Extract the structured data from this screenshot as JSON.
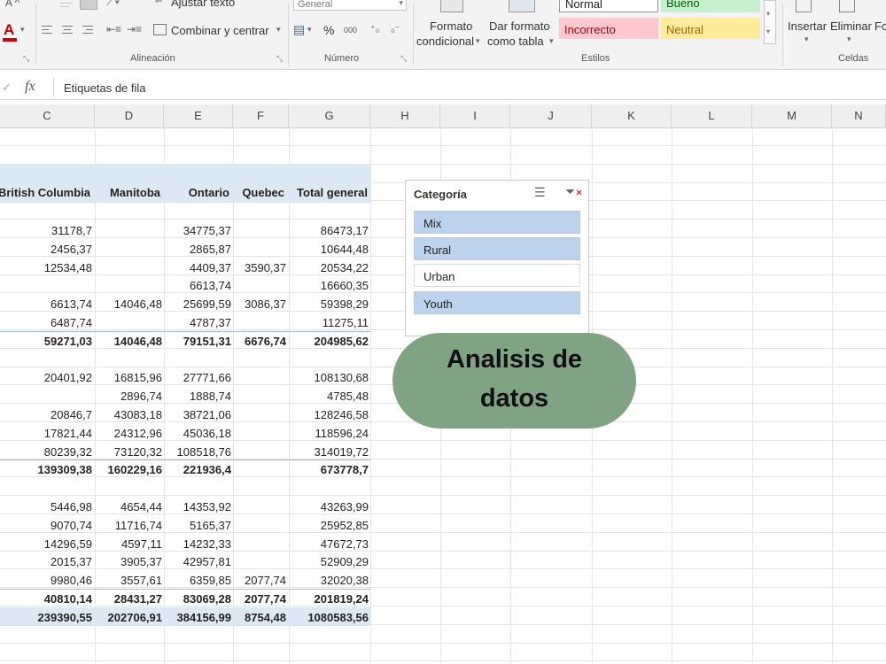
{
  "ribbon": {
    "alignment": {
      "wrap_text": "Ajustar texto",
      "merge_center": "Combinar y centrar",
      "group_label": "Alineación"
    },
    "number": {
      "format_value": "General",
      "percent": "%",
      "thousands": "000",
      "group_label": "Número"
    },
    "styles": {
      "conditional_format_line1": "Formato",
      "conditional_format_line2": "condicional",
      "format_table_line1": "Dar formato",
      "format_table_line2": "como tabla",
      "normal": "Normal",
      "good": "Bueno",
      "bad": "Incorrecto",
      "neutral": "Neutral",
      "group_label": "Estilos"
    },
    "cells": {
      "insert": "Insertar",
      "delete": "Eliminar",
      "format_partial": "Fo",
      "group_label": "Celdas"
    },
    "font_color_letter": "A"
  },
  "formula_bar": {
    "fx": "fx",
    "content": "Etiquetas de fila"
  },
  "columns": [
    "C",
    "D",
    "E",
    "F",
    "G",
    "H",
    "I",
    "J",
    "K",
    "L",
    "M",
    "N"
  ],
  "pivot": {
    "headers": [
      "British Columbia",
      "Manitoba",
      "Ontario",
      "Quebec",
      "Total general"
    ],
    "rows": [
      [
        "31178,7",
        "",
        "34775,37",
        "",
        "86473,17"
      ],
      [
        "2456,37",
        "",
        "2865,87",
        "",
        "10644,48"
      ],
      [
        "12534,48",
        "",
        "4409,37",
        "3590,37",
        "20534,22"
      ],
      [
        "",
        "",
        "6613,74",
        "",
        "16660,35"
      ],
      [
        "6613,74",
        "14046,48",
        "25699,59",
        "3086,37",
        "59398,29"
      ],
      [
        "6487,74",
        "",
        "4787,37",
        "",
        "11275,11"
      ],
      [
        "59271,03",
        "14046,48",
        "79151,31",
        "6676,74",
        "204985,62"
      ],
      [
        "",
        "",
        "",
        "",
        ""
      ],
      [
        "20401,92",
        "16815,96",
        "27771,66",
        "",
        "108130,68"
      ],
      [
        "",
        "2896,74",
        "1888,74",
        "",
        "4785,48"
      ],
      [
        "20846,7",
        "43083,18",
        "38721,06",
        "",
        "128246,58"
      ],
      [
        "17821,44",
        "24312,96",
        "45036,18",
        "",
        "118596,24"
      ],
      [
        "80239,32",
        "73120,32",
        "108518,76",
        "",
        "314019,72"
      ],
      [
        "139309,38",
        "160229,16",
        "221936,4",
        "",
        "673778,7"
      ],
      [
        "",
        "",
        "",
        "",
        ""
      ],
      [
        "5446,98",
        "4654,44",
        "14353,92",
        "",
        "43263,99"
      ],
      [
        "9070,74",
        "11716,74",
        "5165,37",
        "",
        "25952,85"
      ],
      [
        "14296,59",
        "4597,11",
        "14232,33",
        "",
        "47672,73"
      ],
      [
        "2015,37",
        "3905,37",
        "42957,81",
        "",
        "52909,29"
      ],
      [
        "9980,46",
        "3557,61",
        "6359,85",
        "2077,74",
        "32020,38"
      ],
      [
        "40810,14",
        "28431,27",
        "83069,28",
        "2077,74",
        "201819,24"
      ],
      [
        "239390,55",
        "202706,91",
        "384156,99",
        "8754,48",
        "1080583,56"
      ]
    ],
    "bold_rows": [
      6,
      13,
      20,
      21
    ]
  },
  "slicer": {
    "title": "Categoría",
    "items": [
      {
        "label": "Mix",
        "selected": true
      },
      {
        "label": "Rural",
        "selected": true
      },
      {
        "label": "Urban",
        "selected": false
      },
      {
        "label": "Youth",
        "selected": true
      }
    ]
  },
  "badge": {
    "line1": "Analisis de",
    "line2": "datos",
    "color": "#7fa383"
  }
}
